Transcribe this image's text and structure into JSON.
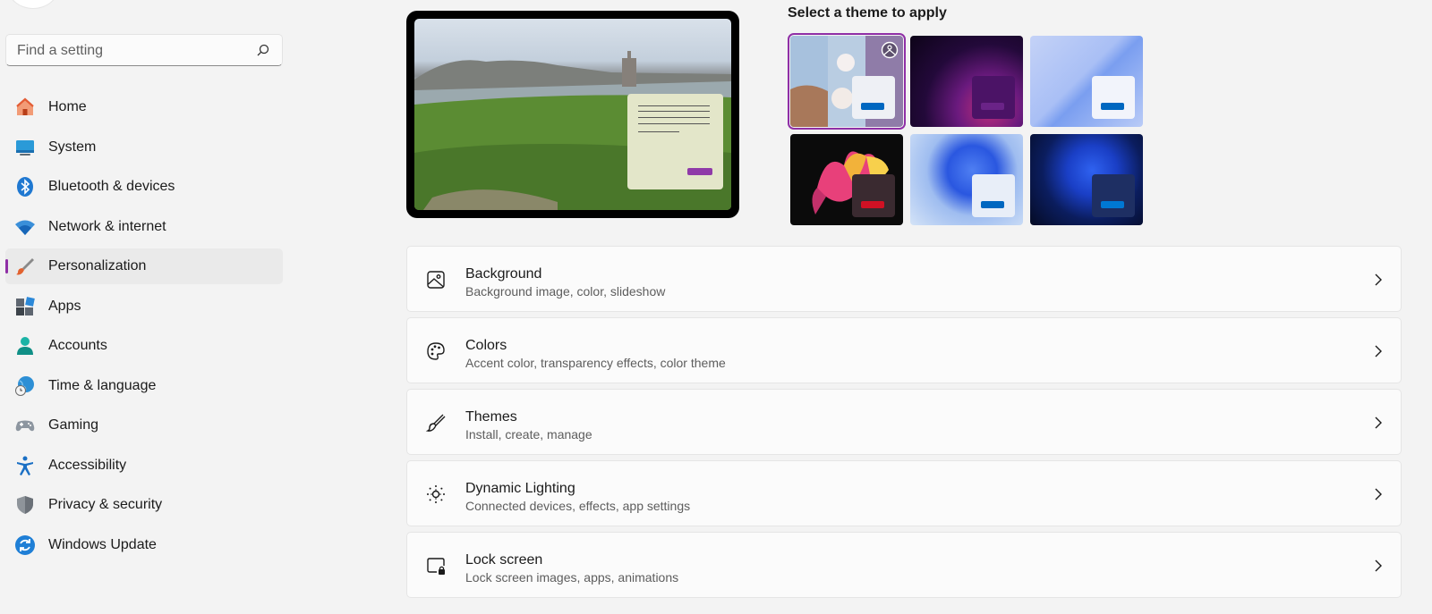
{
  "search": {
    "placeholder": "Find a setting"
  },
  "sidebar": {
    "items": [
      {
        "label": "Home",
        "icon": "home-icon"
      },
      {
        "label": "System",
        "icon": "system-icon"
      },
      {
        "label": "Bluetooth & devices",
        "icon": "bluetooth-icon"
      },
      {
        "label": "Network & internet",
        "icon": "wifi-icon"
      },
      {
        "label": "Personalization",
        "icon": "brush-icon",
        "active": true
      },
      {
        "label": "Apps",
        "icon": "apps-icon"
      },
      {
        "label": "Accounts",
        "icon": "person-icon"
      },
      {
        "label": "Time & language",
        "icon": "globe-clock-icon"
      },
      {
        "label": "Gaming",
        "icon": "gamepad-icon"
      },
      {
        "label": "Accessibility",
        "icon": "accessibility-icon"
      },
      {
        "label": "Privacy & security",
        "icon": "shield-icon"
      },
      {
        "label": "Windows Update",
        "icon": "update-icon"
      }
    ]
  },
  "themes": {
    "title": "Select a theme to apply",
    "selected_index": 0
  },
  "cards": [
    {
      "title": "Background",
      "subtitle": "Background image, color, slideshow",
      "icon": "image-icon"
    },
    {
      "title": "Colors",
      "subtitle": "Accent color, transparency effects, color theme",
      "icon": "palette-icon"
    },
    {
      "title": "Themes",
      "subtitle": "Install, create, manage",
      "icon": "brush-icon"
    },
    {
      "title": "Dynamic Lighting",
      "subtitle": "Connected devices, effects, app settings",
      "icon": "lighting-icon"
    },
    {
      "title": "Lock screen",
      "subtitle": "Lock screen images, apps, animations",
      "icon": "lock-screen-icon"
    }
  ],
  "colors": {
    "accent": "#8f2fa6",
    "blue": "#0067c0"
  }
}
